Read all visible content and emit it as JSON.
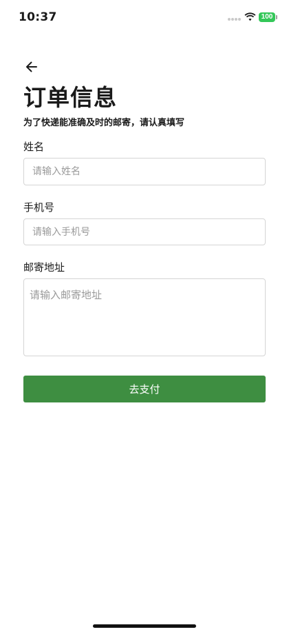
{
  "status_bar": {
    "time": "10:37",
    "battery": "100"
  },
  "header": {
    "title": "订单信息",
    "subtitle": "为了快递能准确及时的邮寄，请认真填写"
  },
  "form": {
    "name": {
      "label": "姓名",
      "placeholder": "请输入姓名",
      "value": ""
    },
    "phone": {
      "label": "手机号",
      "placeholder": "请输入手机号",
      "value": ""
    },
    "address": {
      "label": "邮寄地址",
      "placeholder": "请输入邮寄地址",
      "value": ""
    }
  },
  "actions": {
    "pay_label": "去支付"
  },
  "icons": {
    "back": "arrow-left-icon",
    "wifi": "wifi-icon",
    "battery": "battery-icon",
    "signal": "signal-icon"
  },
  "colors": {
    "accent": "#3e8e41",
    "battery": "#34c759"
  }
}
